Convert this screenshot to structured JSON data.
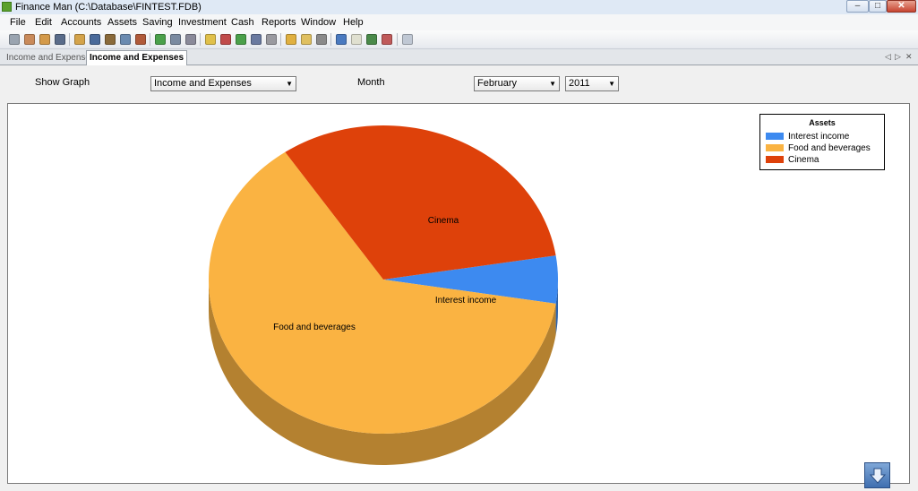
{
  "window": {
    "title": "Finance Man (C:\\Database\\FINTEST.FDB)"
  },
  "menu": [
    "File",
    "Edit",
    "Accounts",
    "Assets",
    "Saving",
    "Investment",
    "Cash",
    "Reports",
    "Window",
    "Help"
  ],
  "tabs": [
    "Income and Expenses",
    "Income and Expenses"
  ],
  "controls": {
    "show_graph_label": "Show Graph",
    "graph_value": "Income and Expenses",
    "month_label": "Month",
    "month_value": "February",
    "year_value": "2011"
  },
  "chart_data": {
    "type": "pie",
    "style": "3d",
    "legend_title": "Assets",
    "legend_position": "top-right",
    "slices": [
      {
        "label": "Interest income",
        "percent": 5,
        "color": "#3d8af0"
      },
      {
        "label": "Food and beverages",
        "percent": 63,
        "color": "#fab342"
      },
      {
        "label": "Cinema",
        "percent": 32,
        "color": "#de410a"
      }
    ]
  },
  "colors": {
    "interest": "#3d8af0",
    "food": "#fab342",
    "cinema": "#de410a"
  }
}
